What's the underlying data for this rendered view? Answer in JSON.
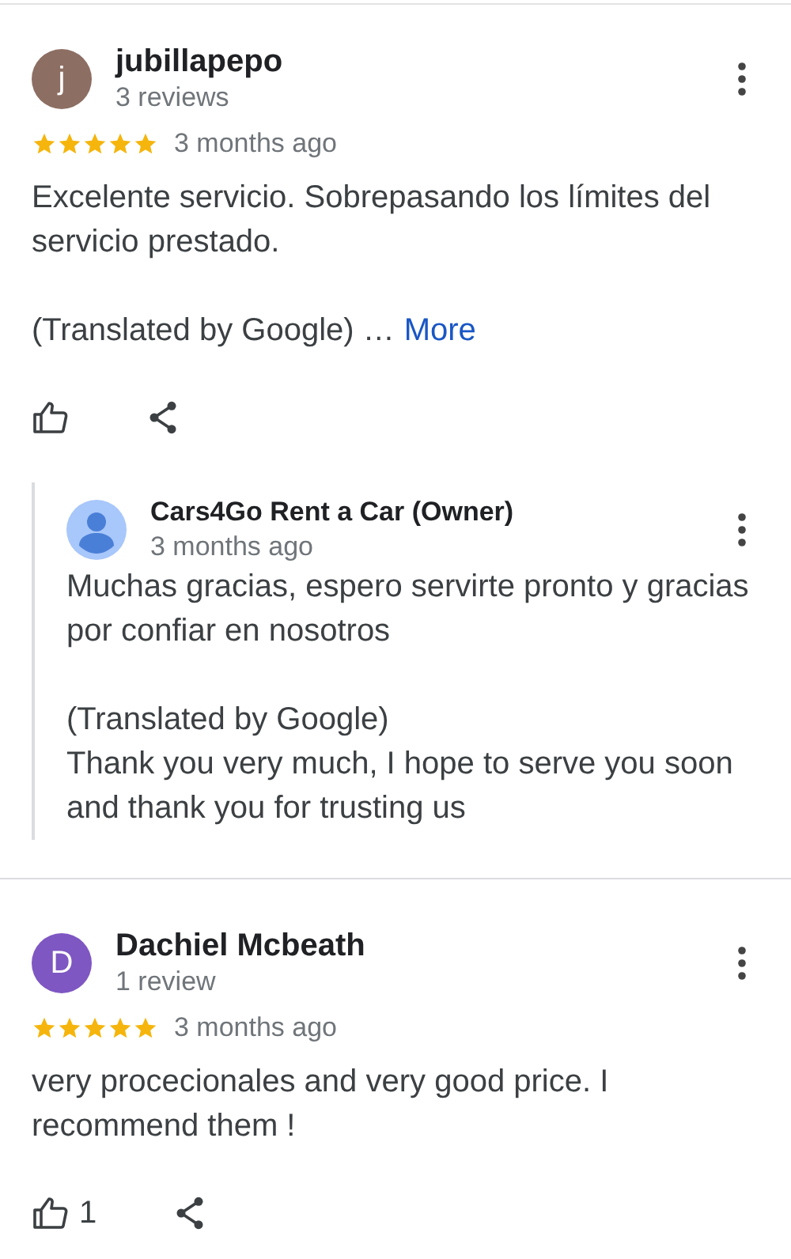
{
  "reviews": [
    {
      "avatar_letter": "j",
      "color": "#8d6e63",
      "name": "jubillapepo",
      "review_count": "3 reviews",
      "stars": 5,
      "time": "3 months ago",
      "body": [
        "Excelente servicio. Sobrepasando los límites del servicio prestado.",
        "(Translated by Google) …"
      ],
      "more_link": "More",
      "reply": {
        "name": "Cars4Go Rent a Car (Owner)",
        "time": "3 months ago",
        "body": [
          "Muchas gracias, espero servirte pronto y gracias por confiar en nosotros",
          "(Translated by Google)\nThank you very much, I hope to serve you soon and thank you for trusting us"
        ]
      }
    },
    {
      "avatar_letter": "D",
      "color": "#7e57c2",
      "name": "Dachiel Mcbeath",
      "review_count": "1 review",
      "stars": 5,
      "time": "3 months ago",
      "body": [
        "very procecionales and very good price. I recommend them !"
      ],
      "likes": "1"
    }
  ]
}
